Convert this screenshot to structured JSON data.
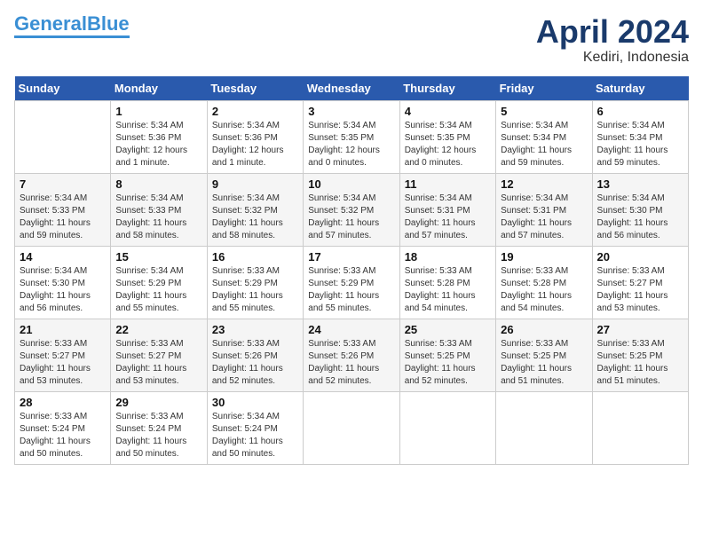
{
  "header": {
    "logo_line1": "General",
    "logo_line2": "Blue",
    "month_title": "April 2024",
    "location": "Kediri, Indonesia"
  },
  "days_of_week": [
    "Sunday",
    "Monday",
    "Tuesday",
    "Wednesday",
    "Thursday",
    "Friday",
    "Saturday"
  ],
  "weeks": [
    [
      {
        "day": "",
        "info": ""
      },
      {
        "day": "1",
        "info": "Sunrise: 5:34 AM\nSunset: 5:36 PM\nDaylight: 12 hours\nand 1 minute."
      },
      {
        "day": "2",
        "info": "Sunrise: 5:34 AM\nSunset: 5:36 PM\nDaylight: 12 hours\nand 1 minute."
      },
      {
        "day": "3",
        "info": "Sunrise: 5:34 AM\nSunset: 5:35 PM\nDaylight: 12 hours\nand 0 minutes."
      },
      {
        "day": "4",
        "info": "Sunrise: 5:34 AM\nSunset: 5:35 PM\nDaylight: 12 hours\nand 0 minutes."
      },
      {
        "day": "5",
        "info": "Sunrise: 5:34 AM\nSunset: 5:34 PM\nDaylight: 11 hours\nand 59 minutes."
      },
      {
        "day": "6",
        "info": "Sunrise: 5:34 AM\nSunset: 5:34 PM\nDaylight: 11 hours\nand 59 minutes."
      }
    ],
    [
      {
        "day": "7",
        "info": "Sunrise: 5:34 AM\nSunset: 5:33 PM\nDaylight: 11 hours\nand 59 minutes."
      },
      {
        "day": "8",
        "info": "Sunrise: 5:34 AM\nSunset: 5:33 PM\nDaylight: 11 hours\nand 58 minutes."
      },
      {
        "day": "9",
        "info": "Sunrise: 5:34 AM\nSunset: 5:32 PM\nDaylight: 11 hours\nand 58 minutes."
      },
      {
        "day": "10",
        "info": "Sunrise: 5:34 AM\nSunset: 5:32 PM\nDaylight: 11 hours\nand 57 minutes."
      },
      {
        "day": "11",
        "info": "Sunrise: 5:34 AM\nSunset: 5:31 PM\nDaylight: 11 hours\nand 57 minutes."
      },
      {
        "day": "12",
        "info": "Sunrise: 5:34 AM\nSunset: 5:31 PM\nDaylight: 11 hours\nand 57 minutes."
      },
      {
        "day": "13",
        "info": "Sunrise: 5:34 AM\nSunset: 5:30 PM\nDaylight: 11 hours\nand 56 minutes."
      }
    ],
    [
      {
        "day": "14",
        "info": "Sunrise: 5:34 AM\nSunset: 5:30 PM\nDaylight: 11 hours\nand 56 minutes."
      },
      {
        "day": "15",
        "info": "Sunrise: 5:34 AM\nSunset: 5:29 PM\nDaylight: 11 hours\nand 55 minutes."
      },
      {
        "day": "16",
        "info": "Sunrise: 5:33 AM\nSunset: 5:29 PM\nDaylight: 11 hours\nand 55 minutes."
      },
      {
        "day": "17",
        "info": "Sunrise: 5:33 AM\nSunset: 5:29 PM\nDaylight: 11 hours\nand 55 minutes."
      },
      {
        "day": "18",
        "info": "Sunrise: 5:33 AM\nSunset: 5:28 PM\nDaylight: 11 hours\nand 54 minutes."
      },
      {
        "day": "19",
        "info": "Sunrise: 5:33 AM\nSunset: 5:28 PM\nDaylight: 11 hours\nand 54 minutes."
      },
      {
        "day": "20",
        "info": "Sunrise: 5:33 AM\nSunset: 5:27 PM\nDaylight: 11 hours\nand 53 minutes."
      }
    ],
    [
      {
        "day": "21",
        "info": "Sunrise: 5:33 AM\nSunset: 5:27 PM\nDaylight: 11 hours\nand 53 minutes."
      },
      {
        "day": "22",
        "info": "Sunrise: 5:33 AM\nSunset: 5:27 PM\nDaylight: 11 hours\nand 53 minutes."
      },
      {
        "day": "23",
        "info": "Sunrise: 5:33 AM\nSunset: 5:26 PM\nDaylight: 11 hours\nand 52 minutes."
      },
      {
        "day": "24",
        "info": "Sunrise: 5:33 AM\nSunset: 5:26 PM\nDaylight: 11 hours\nand 52 minutes."
      },
      {
        "day": "25",
        "info": "Sunrise: 5:33 AM\nSunset: 5:25 PM\nDaylight: 11 hours\nand 52 minutes."
      },
      {
        "day": "26",
        "info": "Sunrise: 5:33 AM\nSunset: 5:25 PM\nDaylight: 11 hours\nand 51 minutes."
      },
      {
        "day": "27",
        "info": "Sunrise: 5:33 AM\nSunset: 5:25 PM\nDaylight: 11 hours\nand 51 minutes."
      }
    ],
    [
      {
        "day": "28",
        "info": "Sunrise: 5:33 AM\nSunset: 5:24 PM\nDaylight: 11 hours\nand 50 minutes."
      },
      {
        "day": "29",
        "info": "Sunrise: 5:33 AM\nSunset: 5:24 PM\nDaylight: 11 hours\nand 50 minutes."
      },
      {
        "day": "30",
        "info": "Sunrise: 5:34 AM\nSunset: 5:24 PM\nDaylight: 11 hours\nand 50 minutes."
      },
      {
        "day": "",
        "info": ""
      },
      {
        "day": "",
        "info": ""
      },
      {
        "day": "",
        "info": ""
      },
      {
        "day": "",
        "info": ""
      }
    ]
  ]
}
